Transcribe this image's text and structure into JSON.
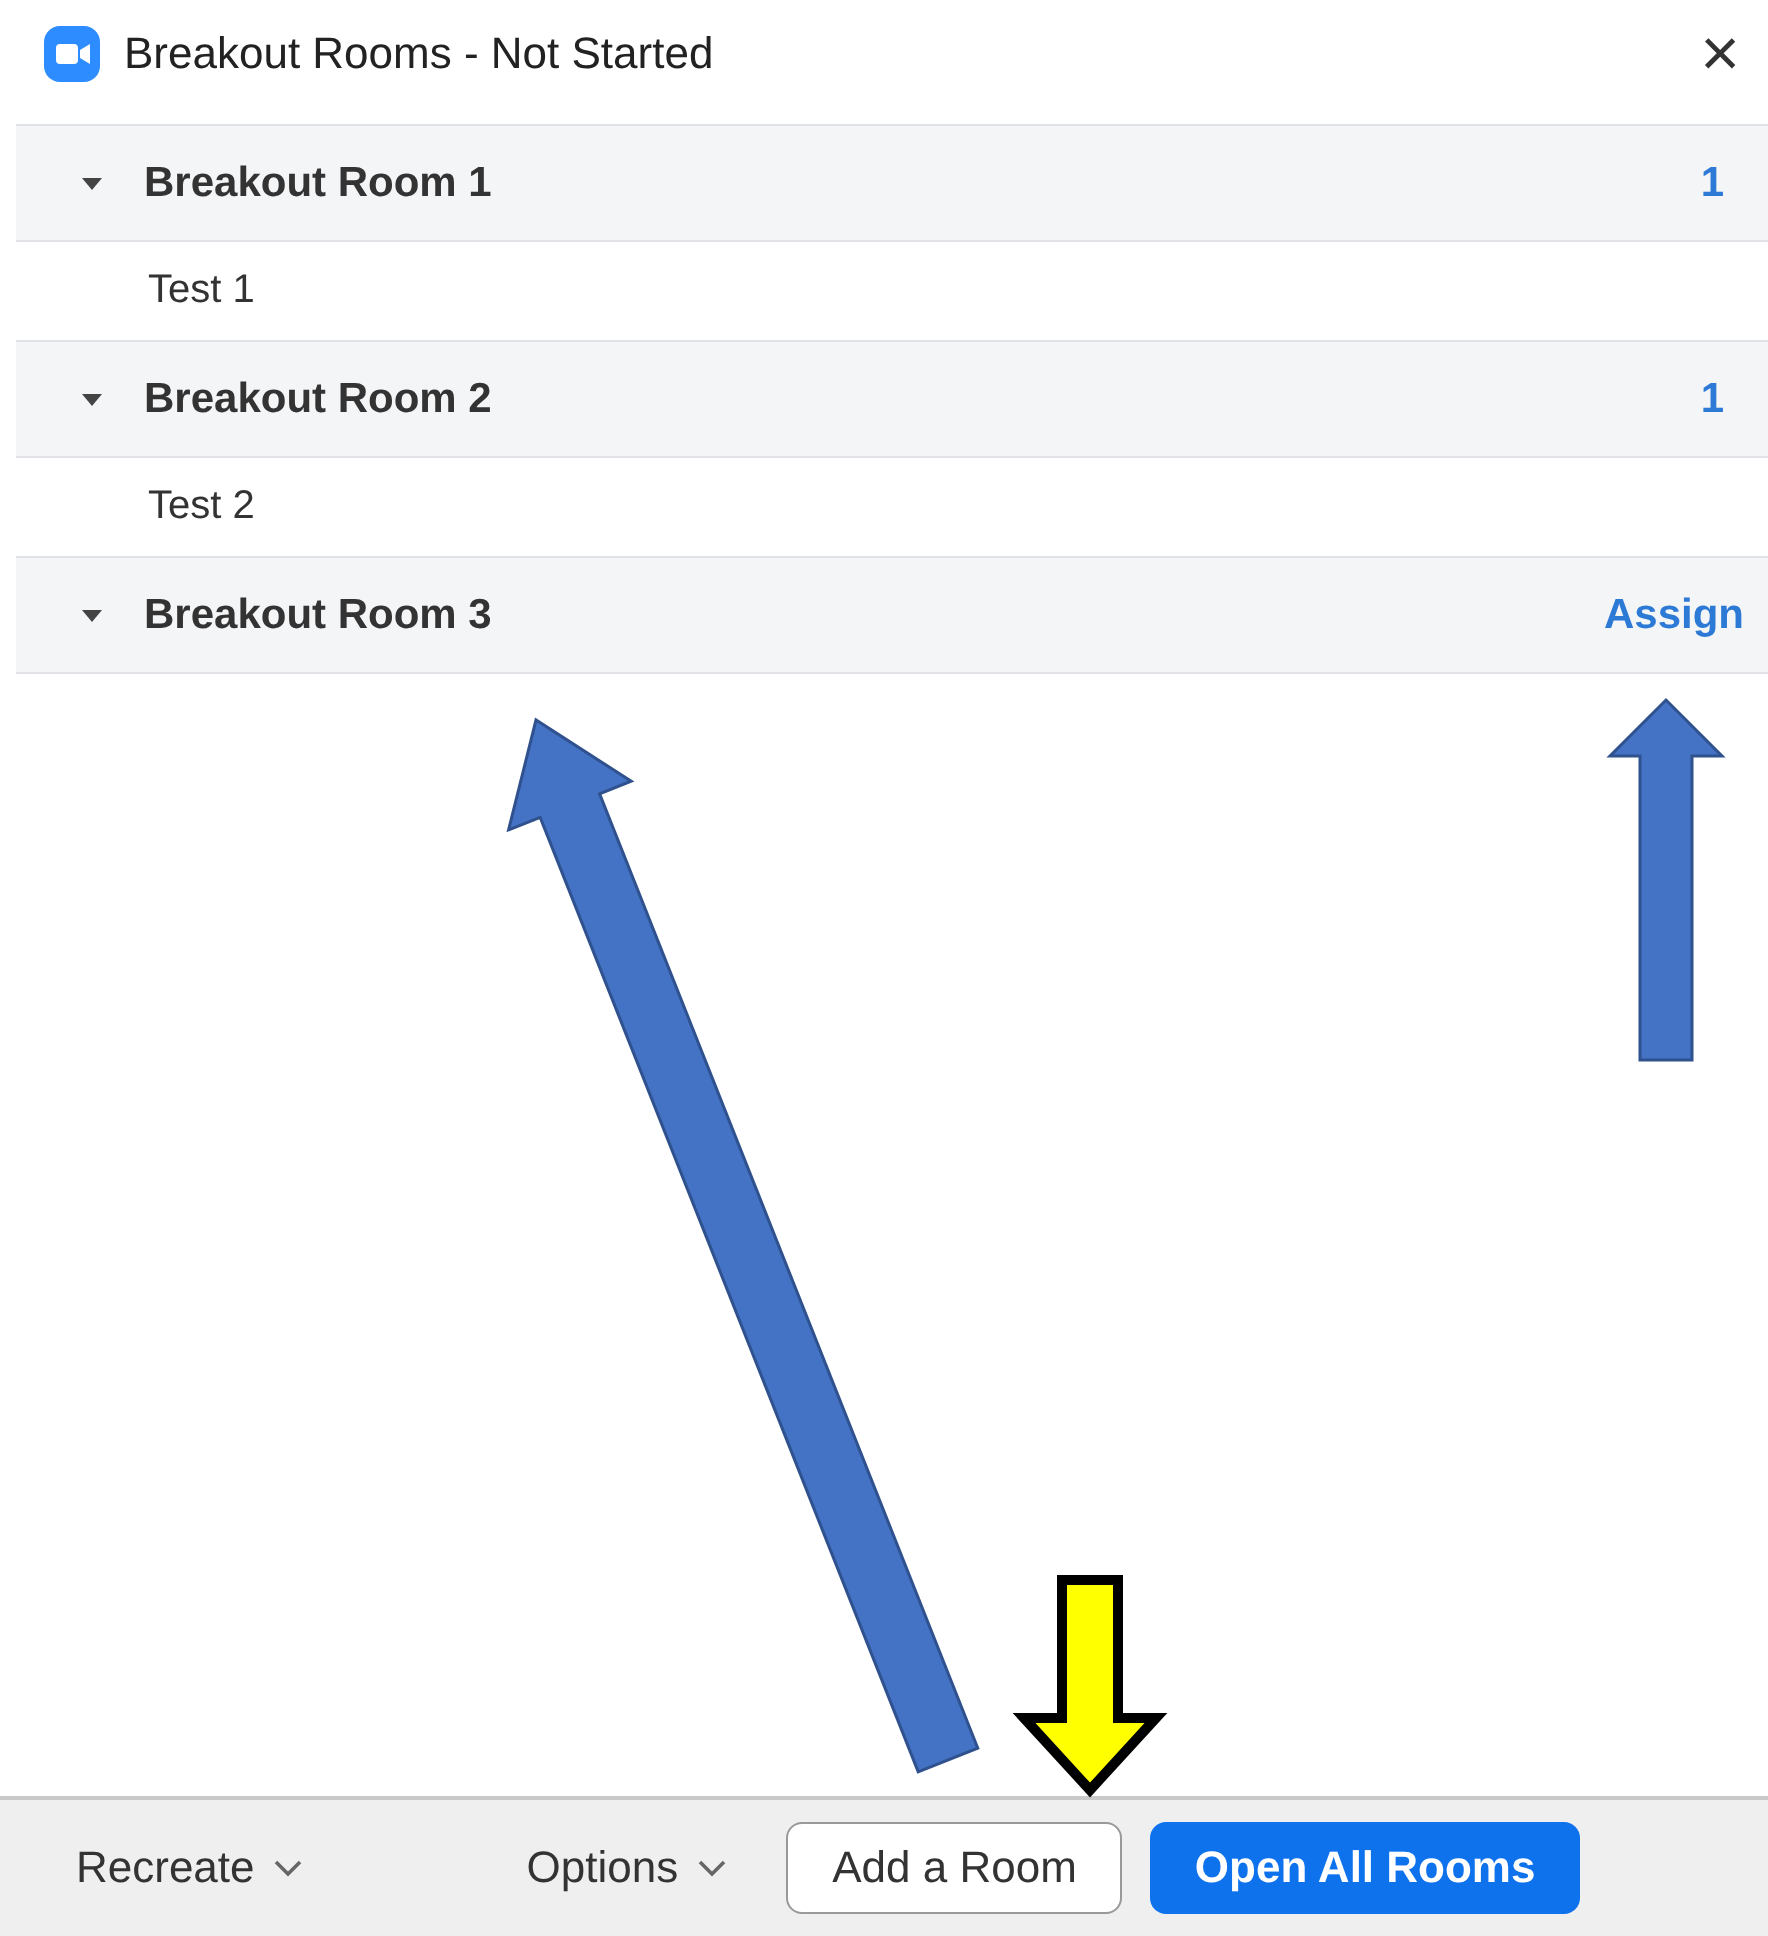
{
  "window": {
    "title": "Breakout Rooms - Not Started",
    "close": "×"
  },
  "rooms": [
    {
      "name": "Breakout Room 1",
      "expanded": true,
      "kind": "count",
      "badge": "1",
      "participants": [
        "Test 1"
      ]
    },
    {
      "name": "Breakout Room 2",
      "expanded": true,
      "kind": "count",
      "badge": "1",
      "participants": [
        "Test 2"
      ]
    },
    {
      "name": "Breakout Room 3",
      "expanded": true,
      "kind": "action",
      "badge": "Assign"
    }
  ],
  "footer": {
    "dropdowns": [
      "Recreate",
      "Options"
    ],
    "buttons": [
      {
        "label": "Add a Room",
        "kind": "secondary"
      },
      {
        "label": "Open All Rooms",
        "kind": "primary"
      }
    ]
  },
  "annotations": [
    {
      "kind": "arrow",
      "color": "#4472c4"
    },
    {
      "kind": "arrow",
      "color": "#4472c4"
    },
    {
      "kind": "arrow",
      "color": "#ffff00"
    }
  ]
}
